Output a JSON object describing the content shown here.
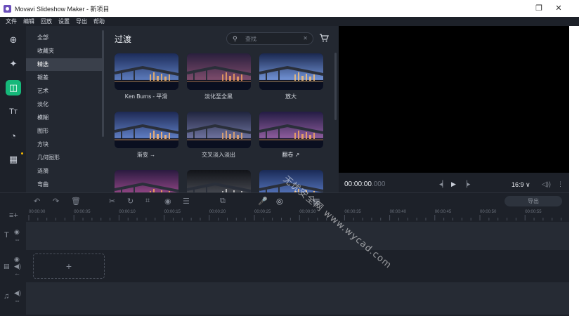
{
  "window": {
    "title": "Movavi Slideshow Maker - 新项目",
    "restore_glyph": "❐",
    "close_glyph": "✕"
  },
  "menu": [
    "文件",
    "编辑",
    "回放",
    "设置",
    "导出",
    "帮助"
  ],
  "rail": {
    "items": [
      {
        "icon": "import-files-icon",
        "glyph": "⊕"
      },
      {
        "icon": "magic-wand-icon",
        "glyph": "✦"
      },
      {
        "icon": "transitions-icon",
        "glyph": "◫"
      },
      {
        "icon": "titles-icon",
        "glyph": "Tт"
      },
      {
        "icon": "stickers-icon",
        "glyph": "◔"
      },
      {
        "icon": "more-tools-icon",
        "glyph": "▦"
      }
    ],
    "active_index": 2
  },
  "categories": {
    "items": [
      "全部",
      "收藏夹",
      "精选",
      "褪差",
      "艺术",
      "淡化",
      "模糊",
      "图形",
      "方块",
      "几何图形",
      "涟漪",
      "弯曲"
    ],
    "active_index": 2
  },
  "gallery": {
    "heading": "过渡",
    "search_placeholder": "查找",
    "items": [
      {
        "label": "Ken Burns - 平滑"
      },
      {
        "label": "淡化至全黑"
      },
      {
        "label": "放大"
      },
      {
        "label": "渐变 →"
      },
      {
        "label": "交叉淡入淡出"
      },
      {
        "label": "翻卷 ↗"
      },
      {
        "label": ""
      },
      {
        "label": ""
      },
      {
        "label": ""
      }
    ]
  },
  "player": {
    "timecode_main": "00:00:00",
    "timecode_ms": ".000",
    "aspect_ratio": "16:9 ∨"
  },
  "timeline": {
    "export_label": "导出",
    "ruler": [
      "00:00:00",
      "00:00:05",
      "00:00:10",
      "00:00:15",
      "00:00:20",
      "00:00:25",
      "00:00:30",
      "00:00:35",
      "00:00:40",
      "00:00:45",
      "00:00:50",
      "00:00:55"
    ],
    "add_slot_glyph": "+"
  },
  "watermark": "无忧安全网 www.wycad.com",
  "colors": {
    "accent": "#16b87a",
    "panel": "#232831",
    "background": "#1d2129",
    "track": "#262b34"
  }
}
